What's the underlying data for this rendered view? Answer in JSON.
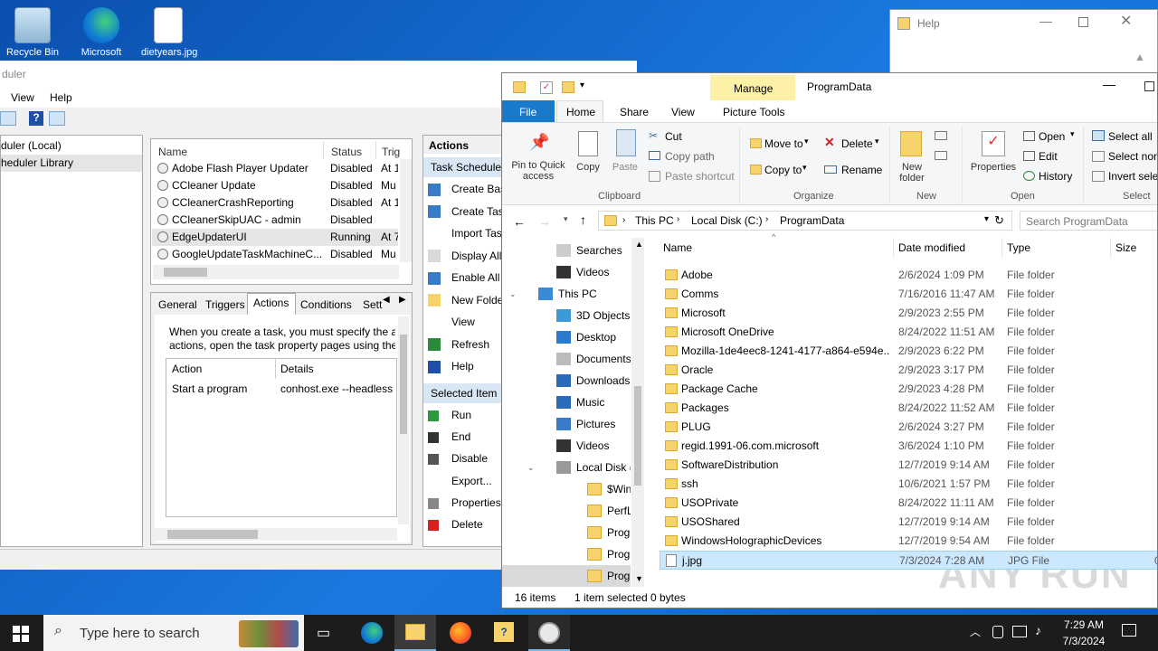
{
  "desktop": {
    "icons": [
      {
        "label": "Recycle Bin"
      },
      {
        "label": "Microsoft"
      },
      {
        "label": "dietyears.jpg"
      }
    ]
  },
  "help_window": {
    "title": "Help"
  },
  "scheduler": {
    "title": "duler",
    "menu": [
      "View",
      "Help"
    ],
    "tree": [
      "duler (Local)",
      "heduler Library"
    ],
    "task_columns": [
      "Name",
      "Status",
      "Trig"
    ],
    "tasks": [
      {
        "name": "Adobe Flash Player Updater",
        "status": "Disabled",
        "trig": "At 1"
      },
      {
        "name": "CCleaner Update",
        "status": "Disabled",
        "trig": "Mu"
      },
      {
        "name": "CCleanerCrashReporting",
        "status": "Disabled",
        "trig": "At 1"
      },
      {
        "name": "CCleanerSkipUAC - admin",
        "status": "Disabled",
        "trig": ""
      },
      {
        "name": "EdgeUpdaterUI",
        "status": "Running",
        "trig": "At 7"
      },
      {
        "name": "GoogleUpdateTaskMachineC...",
        "status": "Disabled",
        "trig": "Mu"
      }
    ],
    "detail_tabs": [
      "General",
      "Triggers",
      "Actions",
      "Conditions",
      "Sett"
    ],
    "detail_text_1": "When you create a task, you must specify the ac",
    "detail_text_2": "actions, open the task property pages using the",
    "action_columns": [
      "Action",
      "Details"
    ],
    "action_row": {
      "action": "Start a program",
      "details": "conhost.exe --headless"
    },
    "actions_title": "Actions",
    "actions_section1": "Task Scheduler",
    "actions_list1": [
      "Create Bas",
      "Create Tas",
      "Import Tas",
      "Display All",
      "Enable All",
      "New Folde",
      "View",
      "Refresh",
      "Help"
    ],
    "actions_section2": "Selected Item",
    "actions_list2": [
      "Run",
      "End",
      "Disable",
      "Export...",
      "Properties",
      "Delete"
    ]
  },
  "explorer": {
    "title": "ProgramData",
    "manage_tab": "Manage",
    "picture_tools": "Picture Tools",
    "tabs": [
      "File",
      "Home",
      "Share",
      "View"
    ],
    "ribbon": {
      "pin": "Pin to Quick access",
      "copy": "Copy",
      "paste": "Paste",
      "cut": "Cut",
      "copy_path": "Copy path",
      "paste_shortcut": "Paste shortcut",
      "clipboard": "Clipboard",
      "move_to": "Move to",
      "copy_to": "Copy to",
      "delete": "Delete",
      "rename": "Rename",
      "organize": "Organize",
      "new_folder": "New folder",
      "new": "New",
      "properties": "Properties",
      "open": "Open",
      "edit": "Edit",
      "history": "History",
      "open_group": "Open",
      "select_all": "Select all",
      "select_none": "Select non",
      "invert": "Invert selec",
      "select_group": "Select"
    },
    "breadcrumb": [
      "This PC",
      "Local Disk (C:)",
      "ProgramData"
    ],
    "search_placeholder": "Search ProgramData",
    "nav": [
      {
        "label": "Searches",
        "indent": 1,
        "icon": "search-folder"
      },
      {
        "label": "Videos",
        "indent": 1,
        "icon": "videos"
      },
      {
        "label": "This PC",
        "indent": 0,
        "icon": "pc"
      },
      {
        "label": "3D Objects",
        "indent": 1,
        "icon": "3d"
      },
      {
        "label": "Desktop",
        "indent": 1,
        "icon": "desktop"
      },
      {
        "label": "Documents",
        "indent": 1,
        "icon": "documents"
      },
      {
        "label": "Downloads",
        "indent": 1,
        "icon": "downloads"
      },
      {
        "label": "Music",
        "indent": 1,
        "icon": "music"
      },
      {
        "label": "Pictures",
        "indent": 1,
        "icon": "pictures"
      },
      {
        "label": "Videos",
        "indent": 1,
        "icon": "videos"
      },
      {
        "label": "Local Disk (C:)",
        "indent": 1,
        "icon": "disk"
      },
      {
        "label": "$WinREAgent",
        "indent": 2,
        "icon": "folder"
      },
      {
        "label": "PerfLogs",
        "indent": 2,
        "icon": "folder"
      },
      {
        "label": "Program Files",
        "indent": 2,
        "icon": "folder"
      },
      {
        "label": "Program Files",
        "indent": 2,
        "icon": "folder"
      },
      {
        "label": "ProgramData",
        "indent": 2,
        "icon": "folder"
      }
    ],
    "columns": [
      "Name",
      "Date modified",
      "Type",
      "Size"
    ],
    "files": [
      {
        "name": "Adobe",
        "date": "2/6/2024 1:09 PM",
        "type": "File folder",
        "size": ""
      },
      {
        "name": "Comms",
        "date": "7/16/2016 11:47 AM",
        "type": "File folder",
        "size": ""
      },
      {
        "name": "Microsoft",
        "date": "2/9/2023 2:55 PM",
        "type": "File folder",
        "size": ""
      },
      {
        "name": "Microsoft OneDrive",
        "date": "8/24/2022 11:51 AM",
        "type": "File folder",
        "size": ""
      },
      {
        "name": "Mozilla-1de4eec8-1241-4177-a864-e594e...",
        "date": "2/9/2023 6:22 PM",
        "type": "File folder",
        "size": ""
      },
      {
        "name": "Oracle",
        "date": "2/9/2023 3:17 PM",
        "type": "File folder",
        "size": ""
      },
      {
        "name": "Package Cache",
        "date": "2/9/2023 4:28 PM",
        "type": "File folder",
        "size": ""
      },
      {
        "name": "Packages",
        "date": "8/24/2022 11:52 AM",
        "type": "File folder",
        "size": ""
      },
      {
        "name": "PLUG",
        "date": "2/6/2024 3:27 PM",
        "type": "File folder",
        "size": ""
      },
      {
        "name": "regid.1991-06.com.microsoft",
        "date": "3/6/2024 1:10 PM",
        "type": "File folder",
        "size": ""
      },
      {
        "name": "SoftwareDistribution",
        "date": "12/7/2019 9:14 AM",
        "type": "File folder",
        "size": ""
      },
      {
        "name": "ssh",
        "date": "10/6/2021 1:57 PM",
        "type": "File folder",
        "size": ""
      },
      {
        "name": "USOPrivate",
        "date": "8/24/2022 11:11 AM",
        "type": "File folder",
        "size": ""
      },
      {
        "name": "USOShared",
        "date": "12/7/2019 9:14 AM",
        "type": "File folder",
        "size": ""
      },
      {
        "name": "WindowsHolographicDevices",
        "date": "12/7/2019 9:54 AM",
        "type": "File folder",
        "size": ""
      },
      {
        "name": "j.jpg",
        "date": "7/3/2024 7:28 AM",
        "type": "JPG File",
        "size": "0"
      }
    ],
    "status_items": "16 items",
    "status_selected": "1 item selected",
    "status_size": "0 bytes"
  },
  "taskbar": {
    "search_placeholder": "Type here to search",
    "time": "7:29 AM",
    "date": "7/3/2024"
  },
  "watermark": "ANY RUN",
  "colors": {
    "accent": "#1979ca",
    "manage": "#fcf1a6",
    "selection": "#cce8ff"
  }
}
